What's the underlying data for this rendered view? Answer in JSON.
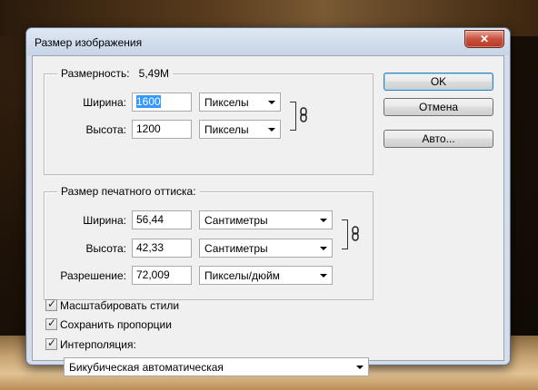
{
  "dialog": {
    "title": "Размер изображения",
    "close_label": "✕"
  },
  "pixel_dims": {
    "group_label": "Размерность:",
    "size_value": "5,49M",
    "width_label": "Ширина:",
    "width_value": "1600",
    "width_unit": "Пикселы",
    "height_label": "Высота:",
    "height_value": "1200",
    "height_unit": "Пикселы",
    "link_icon": "chain-link-icon"
  },
  "print_size": {
    "group_label": "Размер печатного оттиска:",
    "width_label": "Ширина:",
    "width_value": "56,44",
    "width_unit": "Сантиметры",
    "height_label": "Высота:",
    "height_value": "42,33",
    "height_unit": "Сантиметры",
    "resolution_label": "Разрешение:",
    "resolution_value": "72,009",
    "resolution_unit": "Пикселы/дюйм",
    "link_icon": "chain-link-icon"
  },
  "options": {
    "scale_styles": {
      "label": "Масштабировать стили",
      "checked": true
    },
    "constrain": {
      "label": "Сохранить пропорции",
      "checked": true
    },
    "resample": {
      "label": "Интерполяция:",
      "checked": true
    },
    "resample_method": "Бикубическая автоматическая"
  },
  "buttons": {
    "ok": "OK",
    "cancel": "Отмена",
    "auto": "Авто..."
  },
  "colors": {
    "selection": "#3399ff",
    "close_red": "#c9503d",
    "dialog_bg": "#f0f0f0"
  }
}
